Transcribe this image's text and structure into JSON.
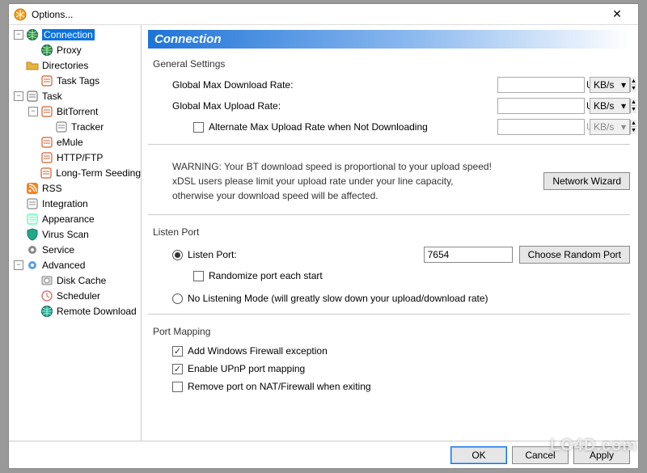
{
  "window": {
    "title": "Options...",
    "close_glyph": "✕"
  },
  "sidebar": {
    "items": [
      {
        "label": "Connection",
        "icon": "globe",
        "level": 0,
        "selected": true,
        "toggle": "-"
      },
      {
        "label": "Proxy",
        "icon": "proxy",
        "level": 1
      },
      {
        "label": "Directories",
        "icon": "folder",
        "level": 0
      },
      {
        "label": "Task Tags",
        "icon": "tag",
        "level": 1
      },
      {
        "label": "Task",
        "icon": "task",
        "level": 0,
        "toggle": "-"
      },
      {
        "label": "BitTorrent",
        "icon": "bt",
        "level": 1,
        "toggle": "-"
      },
      {
        "label": "Tracker",
        "icon": "tracker",
        "level": 2
      },
      {
        "label": "eMule",
        "icon": "emule",
        "level": 1
      },
      {
        "label": "HTTP/FTP",
        "icon": "http",
        "level": 1
      },
      {
        "label": "Long-Term Seeding",
        "icon": "seed",
        "level": 1
      },
      {
        "label": "RSS",
        "icon": "rss",
        "level": 0
      },
      {
        "label": "Integration",
        "icon": "puzzle",
        "level": 0
      },
      {
        "label": "Appearance",
        "icon": "palette",
        "level": 0
      },
      {
        "label": "Virus Scan",
        "icon": "shield",
        "level": 0
      },
      {
        "label": "Service",
        "icon": "gear",
        "level": 0
      },
      {
        "label": "Advanced",
        "icon": "gear2",
        "level": 0,
        "toggle": "-"
      },
      {
        "label": "Disk Cache",
        "icon": "disk",
        "level": 1
      },
      {
        "label": "Scheduler",
        "icon": "clock",
        "level": 1
      },
      {
        "label": "Remote Download",
        "icon": "remote",
        "level": 1
      }
    ]
  },
  "page": {
    "header": "Connection",
    "general": {
      "title": "General Settings",
      "max_dl_label": "Global Max Download Rate:",
      "max_dl_value": "Unlimited",
      "max_ul_label": "Global Max Upload Rate:",
      "max_ul_value": "Unlimited",
      "alt_ul_label": "Alternate Max Upload Rate when Not Downloading",
      "alt_ul_value": "Unlimited",
      "unit": "KB/s",
      "warning": "WARNING: Your BT download speed is proportional to your upload speed!\nxDSL users please limit your upload rate under your line capacity,\notherwise your download speed will be affected.",
      "wizard_btn": "Network Wizard"
    },
    "listen": {
      "title": "Listen Port",
      "port_label": "Listen Port:",
      "port_value": "7654",
      "choose_btn": "Choose Random Port",
      "randomize_label": "Randomize port each start",
      "nolisten_label": "No Listening Mode (will greatly slow down your upload/download rate)"
    },
    "mapping": {
      "title": "Port Mapping",
      "firewall_label": "Add Windows Firewall exception",
      "upnp_label": "Enable UPnP port mapping",
      "remove_label": "Remove port on NAT/Firewall when exiting"
    }
  },
  "footer": {
    "ok": "OK",
    "cancel": "Cancel",
    "apply": "Apply"
  },
  "watermark": "LO4D.com"
}
